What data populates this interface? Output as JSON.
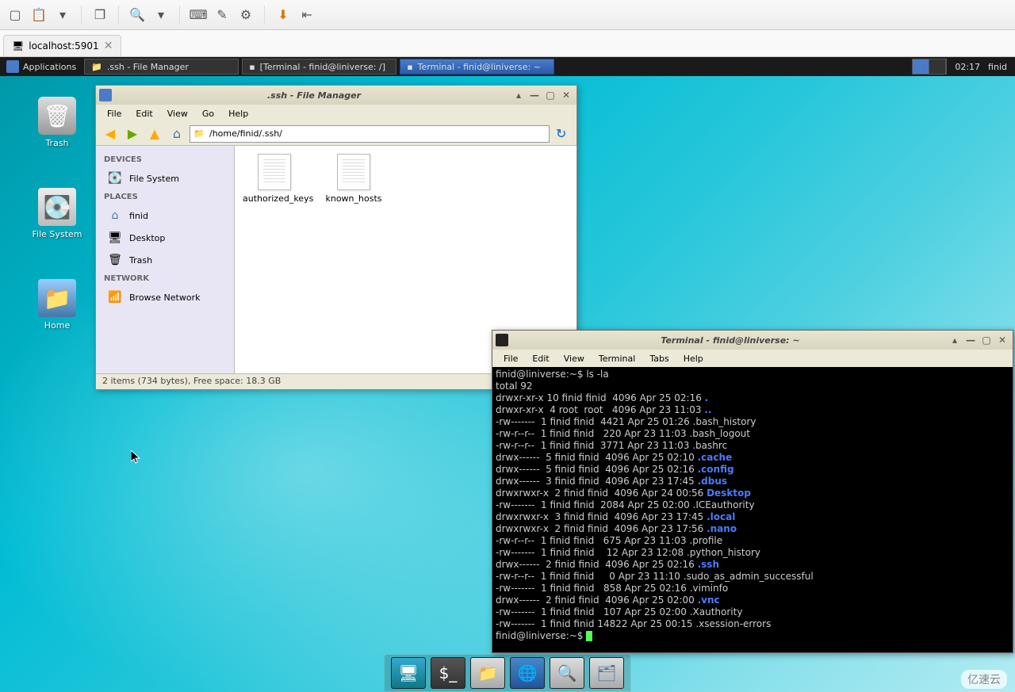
{
  "vnc": {
    "tab_label": "localhost:5901"
  },
  "panel": {
    "applications": "Applications",
    "task1": ".ssh - File Manager",
    "task2": "[Terminal - finid@liniverse: /]",
    "task3": "Terminal - finid@liniverse: ~",
    "clock": "02:17",
    "user": "finid"
  },
  "desktop_icons": {
    "trash": "Trash",
    "filesystem": "File System",
    "home": "Home"
  },
  "filemanager": {
    "title": ".ssh - File Manager",
    "menu": {
      "file": "File",
      "edit": "Edit",
      "view": "View",
      "go": "Go",
      "help": "Help"
    },
    "path": "/home/finid/.ssh/",
    "sidebar": {
      "devices": "DEVICES",
      "file_system": "File System",
      "places": "PLACES",
      "finid": "finid",
      "desktop": "Desktop",
      "trash": "Trash",
      "network": "NETWORK",
      "browse": "Browse Network"
    },
    "files": {
      "f1": "authorized_keys",
      "f2": "known_hosts"
    },
    "status": "2 items (734 bytes), Free space: 18.3 GB"
  },
  "terminal": {
    "title": "Terminal - finid@liniverse: ~",
    "menu": {
      "file": "File",
      "edit": "Edit",
      "view": "View",
      "terminal": "Terminal",
      "tabs": "Tabs",
      "help": "Help"
    },
    "prompt": "finid@liniverse:~$ ",
    "cmd": "ls -la",
    "lines": [
      "total 92",
      "drwxr-xr-x 10 finid finid  4096 Apr 25 02:16 ",
      "drwxr-xr-x  4 root  root   4096 Apr 23 11:03 ",
      "-rw-------  1 finid finid  4421 Apr 25 01:26 .bash_history",
      "-rw-r--r--  1 finid finid   220 Apr 23 11:03 .bash_logout",
      "-rw-r--r--  1 finid finid  3771 Apr 23 11:03 .bashrc",
      "drwx------  5 finid finid  4096 Apr 25 02:10 ",
      "drwx------  5 finid finid  4096 Apr 25 02:16 ",
      "drwx------  3 finid finid  4096 Apr 23 17:45 ",
      "drwxrwxr-x  2 finid finid  4096 Apr 24 00:56 ",
      "-rw-------  1 finid finid  2084 Apr 25 02:00 .ICEauthority",
      "drwxrwxr-x  3 finid finid  4096 Apr 23 17:45 ",
      "drwxrwxr-x  2 finid finid  4096 Apr 23 17:56 ",
      "-rw-r--r--  1 finid finid   675 Apr 23 11:03 .profile",
      "-rw-------  1 finid finid    12 Apr 23 12:08 .python_history",
      "drwx------  2 finid finid  4096 Apr 25 02:16 ",
      "-rw-r--r--  1 finid finid     0 Apr 23 11:10 .sudo_as_admin_successful",
      "-rw-------  1 finid finid   858 Apr 25 02:16 .viminfo",
      "drwx------  2 finid finid  4096 Apr 25 02:00 ",
      "-rw-------  1 finid finid   107 Apr 25 02:00 .Xauthority",
      "-rw-------  1 finid finid 14822 Apr 25 00:15 .xsession-errors"
    ],
    "colored": {
      "dot": ".",
      "dotdot": "..",
      "cache": ".cache",
      "config": ".config",
      "dbus": ".dbus",
      "desktop": "Desktop",
      "local": ".local",
      "nano": ".nano",
      "ssh": ".ssh",
      "vnc": ".vnc"
    }
  },
  "watermark": "亿速云"
}
